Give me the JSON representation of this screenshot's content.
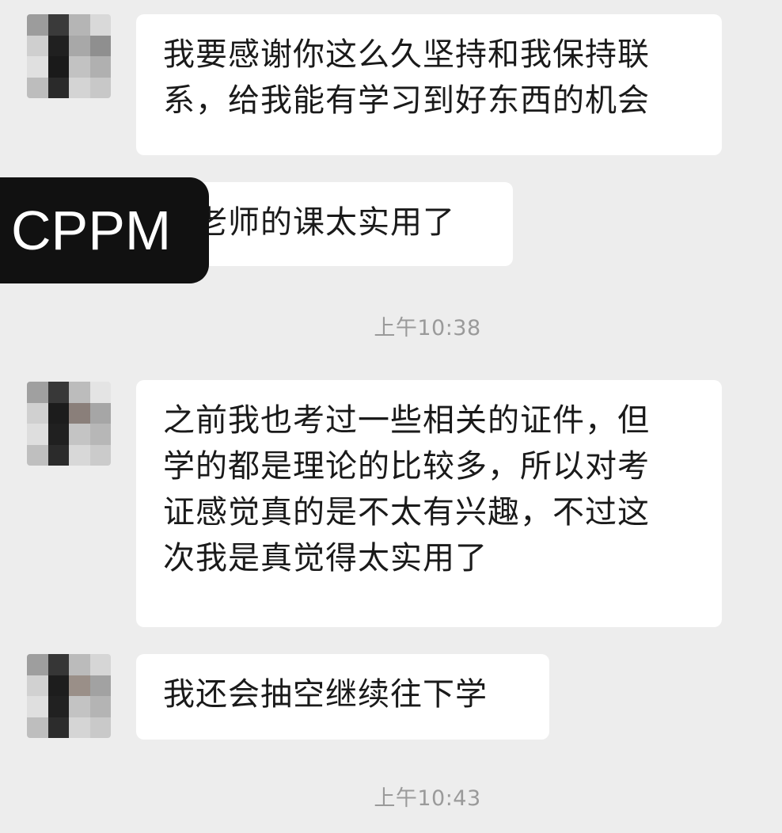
{
  "messages": [
    {
      "lines": [
        "我要感谢你这么久坚持和我保持联",
        "系，给我能有学习到好东西的机会"
      ]
    },
    {
      "lines": [
        "都老师的课太实用了"
      ]
    },
    {
      "lines": [
        "之前我也考过一些相关的证件，但",
        "学的都是理论的比较多，所以对考",
        "证感觉真的是不太有兴趣，不过这",
        "次我是真觉得太实用了"
      ]
    },
    {
      "lines": [
        "我还会抽空继续往下学"
      ]
    }
  ],
  "timestamps": [
    "上午10:38",
    "上午10:43"
  ],
  "watermark": {
    "text": "CPPM"
  },
  "colors": {
    "background": "#ededed",
    "bubble": "#ffffff",
    "text": "#1a1a1a",
    "timestamp": "#9a9a9a",
    "watermark_bg": "#111111"
  }
}
